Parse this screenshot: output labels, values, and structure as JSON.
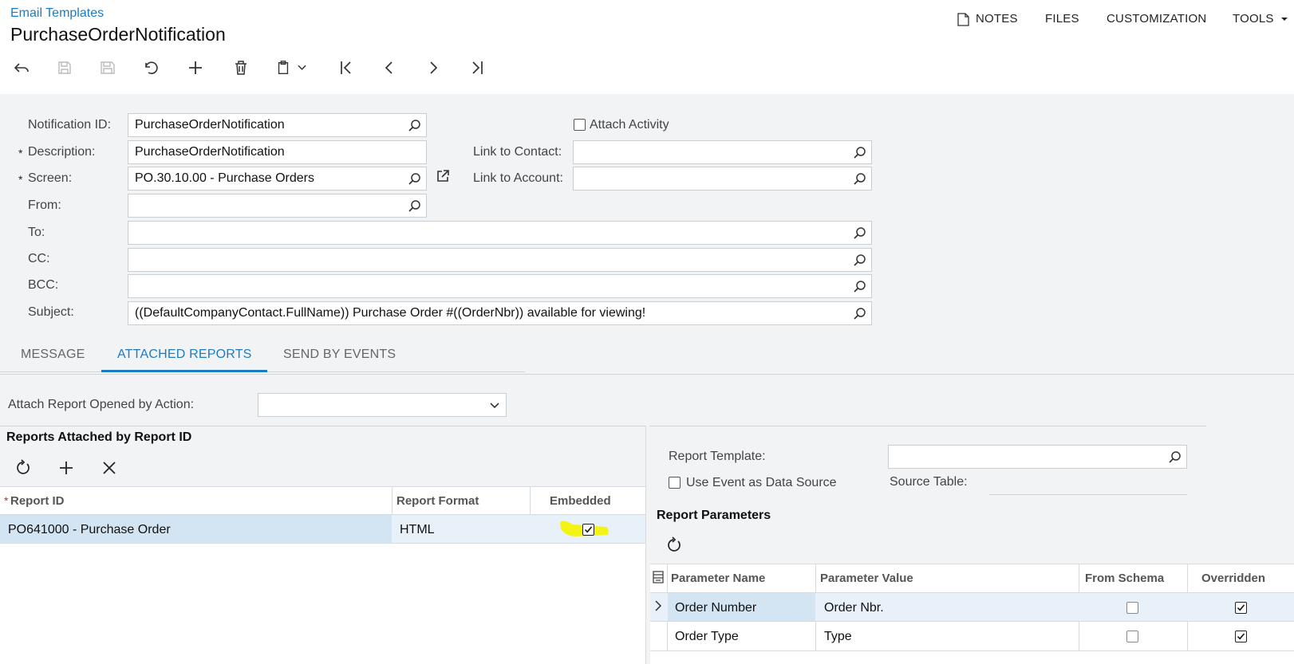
{
  "header": {
    "breadcrumb": "Email Templates",
    "title": "PurchaseOrderNotification",
    "menu": {
      "notes": "NOTES",
      "files": "FILES",
      "customization": "CUSTOMIZATION",
      "tools": "TOOLS"
    }
  },
  "toolbar": {
    "icons": [
      "undo-icon",
      "save-close-icon",
      "save-icon",
      "cancel-icon",
      "add-icon",
      "delete-icon",
      "copy-paste-icon",
      "first-icon",
      "previous-icon",
      "next-icon",
      "last-icon"
    ]
  },
  "form": {
    "notification_id": {
      "label": "Notification ID:",
      "value": "PurchaseOrderNotification"
    },
    "description": {
      "label": "Description:",
      "value": "PurchaseOrderNotification"
    },
    "screen": {
      "label": "Screen:",
      "value": "PO.30.10.00 - Purchase Orders"
    },
    "from": {
      "label": "From:",
      "value": ""
    },
    "to": {
      "label": "To:",
      "value": ""
    },
    "cc": {
      "label": "CC:",
      "value": ""
    },
    "bcc": {
      "label": "BCC:",
      "value": ""
    },
    "subject": {
      "label": "Subject:",
      "value": "((DefaultCompanyContact.FullName)) Purchase Order #((OrderNbr)) available for viewing!"
    },
    "attach_activity": {
      "label": "Attach Activity",
      "checked": false
    },
    "link_to_contact": {
      "label": "Link to Contact:",
      "value": ""
    },
    "link_to_account": {
      "label": "Link to Account:",
      "value": ""
    },
    "required_mark": "*"
  },
  "tabs": [
    {
      "label": "MESSAGE",
      "active": false
    },
    {
      "label": "ATTACHED REPORTS",
      "active": true
    },
    {
      "label": "SEND BY EVENTS",
      "active": false
    }
  ],
  "attach_by_action": {
    "label": "Attach Report Opened by Action:",
    "value": ""
  },
  "reports_panel": {
    "title": "Reports Attached by Report ID",
    "columns": [
      "Report ID",
      "Report Format",
      "Embedded"
    ],
    "rows": [
      {
        "report_id": "PO641000 - Purchase Order",
        "format": "HTML",
        "embedded": true
      }
    ]
  },
  "right_panel": {
    "report_template": {
      "label": "Report Template:",
      "value": ""
    },
    "use_event": {
      "label": "Use Event as Data Source",
      "checked": false
    },
    "source_table": {
      "label": "Source Table:",
      "value": ""
    },
    "params_title": "Report Parameters",
    "columns": [
      "Parameter Name",
      "Parameter Value",
      "From Schema",
      "Overridden"
    ],
    "rows": [
      {
        "name": "Order Number",
        "value": "Order Nbr.",
        "from_schema": false,
        "overridden": true
      },
      {
        "name": "Order Type",
        "value": "Type",
        "from_schema": false,
        "overridden": true
      }
    ]
  },
  "colors": {
    "accent": "#1f7bbf",
    "selected_row": "#d3e5f3",
    "highlight": "#f3f316"
  }
}
